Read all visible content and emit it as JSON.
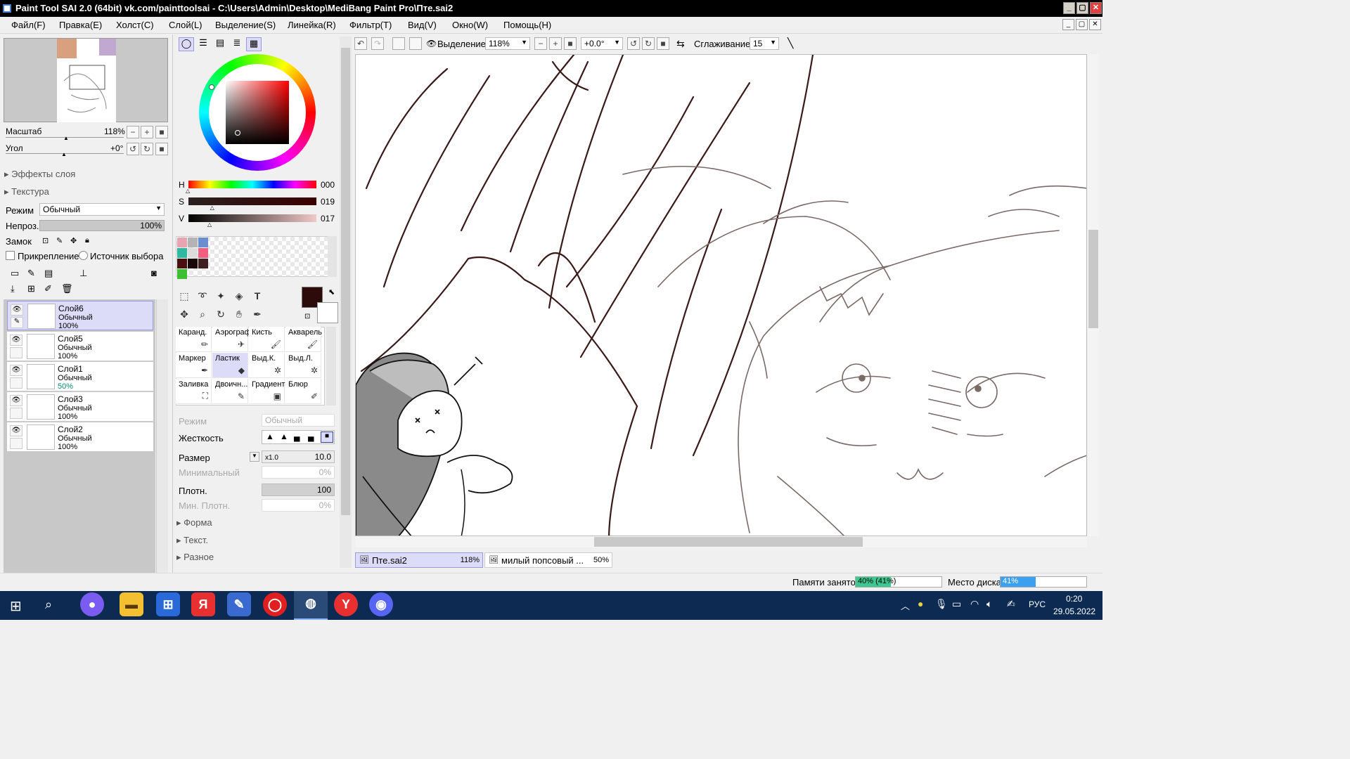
{
  "window": {
    "title": "Paint Tool SAI 2.0 (64bit) vk.com/painttoolsai - C:\\Users\\Admin\\Desktop\\MediBang Paint Pro\\Пте.sai2",
    "min": "_",
    "max": "▢",
    "close": "✕"
  },
  "menu": [
    "Файл(F)",
    "Правка(E)",
    "Холст(C)",
    "Слой(L)",
    "Выделение(S)",
    "Линейка(R)",
    "Фильтр(T)",
    "Вид(V)",
    "Окно(W)",
    "Помощь(H)"
  ],
  "navigator": {
    "scale_label": "Масштаб",
    "scale_value": "118%",
    "angle_label": "Угол",
    "angle_value": "+0°"
  },
  "layer_panel": {
    "effects": "Эффекты слоя",
    "texture": "Текстура",
    "mode_label": "Режим",
    "mode_value": "Обычный",
    "opacity_label": "Непроз.",
    "opacity_value": "100%",
    "lock_label": "Замок",
    "clip_label": "Прикрепление",
    "source_label": "Источник выбора"
  },
  "layers": [
    {
      "name": "Слой6",
      "mode": "Обычный",
      "opacity": "100%"
    },
    {
      "name": "Слой5",
      "mode": "Обычный",
      "opacity": "100%"
    },
    {
      "name": "Слой1",
      "mode": "Обычный",
      "opacity": "50%"
    },
    {
      "name": "Слой3",
      "mode": "Обычный",
      "opacity": "100%"
    },
    {
      "name": "Слой2",
      "mode": "Обычный",
      "opacity": "100%"
    }
  ],
  "color": {
    "h_label": "H",
    "h_value": "000",
    "s_label": "S",
    "s_value": "019",
    "v_label": "V",
    "v_value": "017",
    "h_level": 0.0,
    "s_level": 0.19,
    "v_level": 0.17,
    "primary": "#2e0b0b"
  },
  "swatches": [
    "#e8a4b0",
    "#b4b4b4",
    "#6a8fd0",
    "#2fb9a0",
    "#dcdcdc",
    "#f06080",
    "#4a1010",
    "#1a0808",
    "#402020",
    "#3ac030"
  ],
  "tools": [
    {
      "name": "Каранд."
    },
    {
      "name": "Аэрограф"
    },
    {
      "name": "Кисть"
    },
    {
      "name": "Акварель"
    },
    {
      "name": "Маркер"
    },
    {
      "name": "Ластик"
    },
    {
      "name": "Выд.К."
    },
    {
      "name": "Выд.Л."
    },
    {
      "name": "Заливка"
    },
    {
      "name": "Двоичн..."
    },
    {
      "name": "Градиент"
    },
    {
      "name": "Блюр"
    }
  ],
  "brush": {
    "mode_label": "Режим",
    "mode_value": "Обычный",
    "hardness_label": "Жесткость",
    "size_label": "Размер",
    "size_mult": "x1.0",
    "size_value": "10.0",
    "min_label": "Минимальный",
    "min_value": "0%",
    "density_label": "Плотн.",
    "density_value": "100",
    "min_density_label": "Мин. Плотн.",
    "min_density_value": "0%",
    "shape": "Форма",
    "texture": "Текст.",
    "misc": "Разное"
  },
  "canvas_toolbar": {
    "selection_label": "Выделение",
    "zoom": "118%",
    "angle": "+0.0°",
    "smoothing_label": "Сглаживание",
    "smoothing_value": "15"
  },
  "tabs": [
    {
      "name": "Пте.sai2",
      "zoom": "118%"
    },
    {
      "name": "милый попсовый ...",
      "zoom": "50%"
    }
  ],
  "status": {
    "memory_label": "Памяти занято",
    "memory_value": "40% (41%)",
    "memory_level": 0.41,
    "disk_label": "Место диска",
    "disk_value": "41%",
    "disk_level": 0.41
  },
  "taskbar": {
    "lang": "РУС",
    "time": "0:20",
    "date": "29.05.2022",
    "yandex_letter": "Я"
  }
}
